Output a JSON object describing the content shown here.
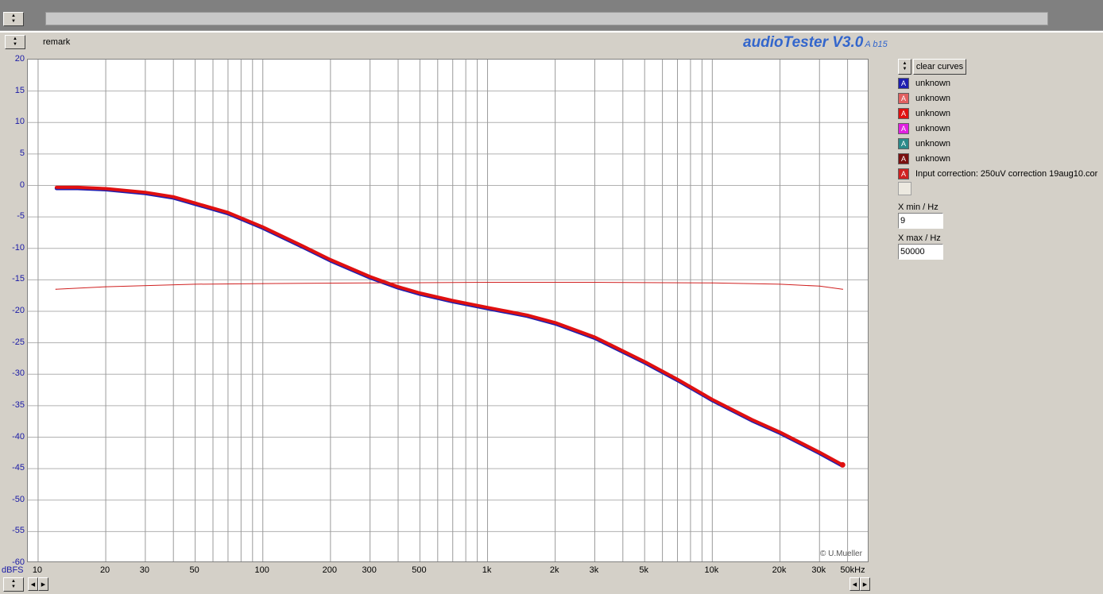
{
  "header": {
    "remark_label": "remark",
    "app_title": "audioTester V3.0",
    "app_version": "A b15"
  },
  "legend": {
    "clear_button": "clear curves",
    "entries": [
      {
        "label": "unknown",
        "color": "#1f1fb0"
      },
      {
        "label": "unknown",
        "color": "#e06060"
      },
      {
        "label": "unknown",
        "color": "#e01010"
      },
      {
        "label": "unknown",
        "color": "#e020e0"
      },
      {
        "label": "unknown",
        "color": "#2a8a8a"
      },
      {
        "label": "unknown",
        "color": "#7a1010"
      },
      {
        "label": "Input correction: 250uV correction 19aug10.cor",
        "color": "#d02020"
      }
    ]
  },
  "controls": {
    "xmin_label": "X min / Hz",
    "xmin_value": "9",
    "xmax_label": "X max / Hz",
    "xmax_value": "50000"
  },
  "axis": {
    "y_unit_label": "dBFS",
    "y_ticks": [
      "20",
      "15",
      "10",
      "5",
      "0",
      "-5",
      "-10",
      "-15",
      "-20",
      "-25",
      "-30",
      "-35",
      "-40",
      "-45",
      "-50",
      "-55",
      "-60"
    ],
    "x_tick_labels": [
      {
        "f": 10,
        "label": "10"
      },
      {
        "f": 20,
        "label": "20"
      },
      {
        "f": 30,
        "label": "30"
      },
      {
        "f": 50,
        "label": "50"
      },
      {
        "f": 100,
        "label": "100"
      },
      {
        "f": 200,
        "label": "200"
      },
      {
        "f": 300,
        "label": "300"
      },
      {
        "f": 500,
        "label": "500"
      },
      {
        "f": 1000,
        "label": "1k"
      },
      {
        "f": 2000,
        "label": "2k"
      },
      {
        "f": 3000,
        "label": "3k"
      },
      {
        "f": 5000,
        "label": "5k"
      },
      {
        "f": 10000,
        "label": "10k"
      },
      {
        "f": 20000,
        "label": "20k"
      },
      {
        "f": 30000,
        "label": "30k"
      },
      {
        "f": 50000,
        "label": "50kHz"
      }
    ]
  },
  "copyright": "© U.Mueller",
  "chart_data": {
    "type": "line",
    "xlabel": "",
    "ylabel": "dBFS",
    "xscale": "log",
    "xlim": [
      9,
      50000
    ],
    "ylim": [
      -60,
      20
    ],
    "grid": true,
    "series": [
      {
        "color": "#1f1fb0",
        "x": [
          12,
          15,
          20,
          30,
          40,
          50,
          70,
          100,
          150,
          200,
          300,
          400,
          500,
          700,
          1000,
          1500,
          2000,
          3000,
          5000,
          7000,
          10000,
          15000,
          20000,
          30000,
          38000
        ],
        "y": [
          -0.5,
          -0.5,
          -0.7,
          -1.3,
          -2,
          -3,
          -4.5,
          -6.8,
          -9.8,
          -12,
          -14.7,
          -16.3,
          -17.3,
          -18.5,
          -19.6,
          -20.8,
          -22,
          -24.3,
          -28.2,
          -31,
          -34.2,
          -37.4,
          -39.4,
          -42.6,
          -44.6
        ]
      },
      {
        "color": "#e01010",
        "x": [
          12,
          15,
          20,
          30,
          40,
          50,
          70,
          100,
          150,
          200,
          300,
          400,
          500,
          700,
          1000,
          1500,
          2000,
          3000,
          5000,
          7000,
          10000,
          15000,
          20000,
          30000,
          38000
        ],
        "y": [
          -0.3,
          -0.3,
          -0.5,
          -1.1,
          -1.8,
          -2.8,
          -4.3,
          -6.6,
          -9.6,
          -11.8,
          -14.5,
          -16.1,
          -17.1,
          -18.3,
          -19.4,
          -20.6,
          -21.8,
          -24.1,
          -28,
          -30.8,
          -34,
          -37.2,
          -39.2,
          -42.4,
          -44.4
        ]
      },
      {
        "color": "#d02020",
        "x": [
          12,
          20,
          50,
          100,
          300,
          1000,
          3000,
          10000,
          20000,
          30000,
          38000
        ],
        "y": [
          -16.5,
          -16.1,
          -15.7,
          -15.6,
          -15.5,
          -15.4,
          -15.4,
          -15.5,
          -15.7,
          -16.0,
          -16.5
        ]
      },
      {
        "color": "#e020e0",
        "x": [
          12,
          38000
        ],
        "y": [
          -60,
          -60
        ]
      }
    ]
  }
}
